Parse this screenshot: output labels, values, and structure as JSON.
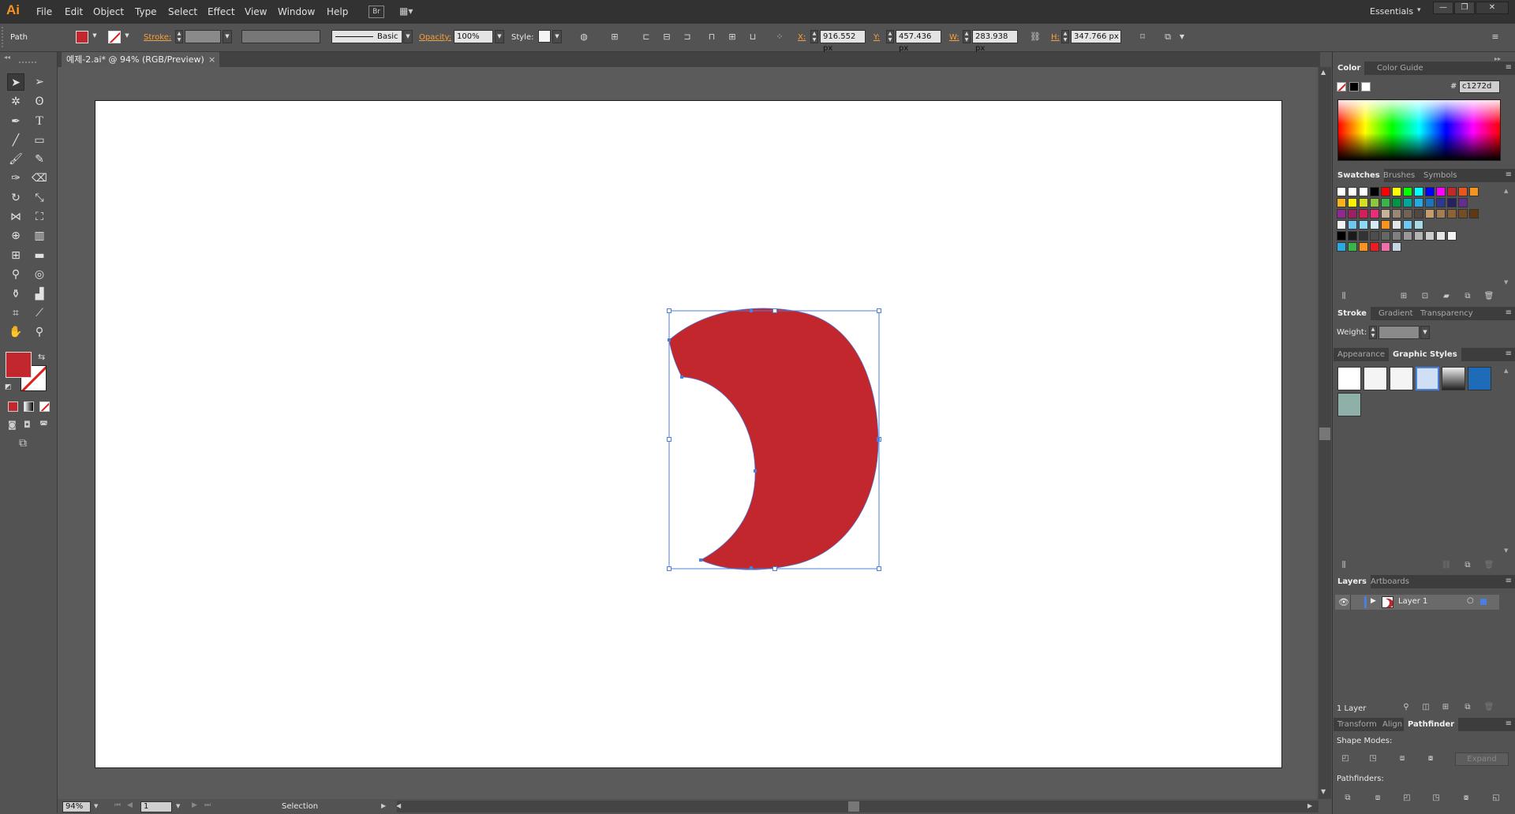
{
  "app": {
    "logo": "Ai",
    "workspace": "Essentials",
    "workspace_arrow": "▾"
  },
  "menu": [
    "File",
    "Edit",
    "Object",
    "Type",
    "Select",
    "Effect",
    "View",
    "Window",
    "Help"
  ],
  "menu_icons": {
    "bridge": "Br",
    "arrange": "▦▾"
  },
  "window_buttons": [
    "—",
    "❐",
    "✕"
  ],
  "control": {
    "object_type": "Path",
    "stroke_label": "Stroke:",
    "brush_label": "Basic",
    "opacity_label": "Opacity:",
    "opacity_value": "100%",
    "style_label": "Style:",
    "x_label": "X:",
    "x_value": "916.552 px",
    "y_label": "Y:",
    "y_value": "457.436 px",
    "w_label": "W:",
    "w_value": "283.938 px",
    "h_label": "H:",
    "h_value": "347.766 px"
  },
  "document": {
    "tab_title": "예제-2.ai* @ 94% (RGB/Preview)",
    "tab_close": "×",
    "fill_color": "#c1272d",
    "selection_color": "#4a7fe0"
  },
  "status": {
    "zoom": "94%",
    "artboard_number": "1",
    "mode": "Selection"
  },
  "panels": {
    "color": {
      "tabs": [
        "Color",
        "Color Guide"
      ],
      "hex_symbol": "#",
      "hex_value": "c1272d"
    },
    "swatches": {
      "tabs": [
        "Swatches",
        "Brushes",
        "Symbols"
      ]
    },
    "stroke": {
      "tabs": [
        "Stroke",
        "Gradient",
        "Transparency"
      ],
      "weight_label": "Weight:"
    },
    "appearance": {
      "tabs": [
        "Appearance",
        "Graphic Styles"
      ]
    },
    "layers": {
      "tabs": [
        "Layers",
        "Artboards"
      ],
      "layer_name": "Layer 1",
      "count_label": "1 Layer"
    },
    "pathfinder": {
      "tabs": [
        "Transform",
        "Align",
        "Pathfinder"
      ],
      "shape_modes_label": "Shape Modes:",
      "expand_label": "Expand",
      "pathfinders_label": "Pathfinders:"
    }
  },
  "swatch_rows": [
    [
      "#ffffff",
      "#ffffff",
      "#ffffff",
      "#000000",
      "#ff0000",
      "#ffff00",
      "#00ff00",
      "#00ffff",
      "#0000ff",
      "#ff00ff",
      "#c1272d",
      "#e8551d",
      "#f7941d"
    ],
    [
      "#f7b21d",
      "#fff200",
      "#d7df23",
      "#8dc63f",
      "#39b54a",
      "#009444",
      "#00a79d",
      "#27aae1",
      "#1c75bc",
      "#2b3990",
      "#262262",
      "#662d91"
    ],
    [
      "#92278f",
      "#9e1f63",
      "#da1c5c",
      "#ee2a7b",
      "#c7b299",
      "#998675",
      "#736357",
      "#534741",
      "#c69c6d",
      "#a67c52",
      "#8c6239",
      "#754c24",
      "#603913"
    ],
    [
      "#f2f2f2",
      "#6fc6f0",
      "#8ed8f8",
      "#d6eaf4",
      "#f7941d",
      "#e6e6e6",
      "#6fc6f0",
      "#a7d9e9"
    ],
    [
      "#000000",
      "#1a1a1a",
      "#333333",
      "#4d4d4d",
      "#666666",
      "#808080",
      "#999999",
      "#b3b3b3",
      "#cccccc",
      "#e6e6e6",
      "#f2f2f2"
    ],
    [
      "#29abe2",
      "#39b54a",
      "#f7931e",
      "#ed1c24",
      "#f06eaa",
      "#c5d6e3"
    ]
  ],
  "icons": {
    "tools": [
      "selection-icon",
      "direct-selection-icon",
      "magic-wand-icon",
      "lasso-icon",
      "pen-icon",
      "type-icon",
      "line-icon",
      "rectangle-icon",
      "paintbrush-icon",
      "pencil-icon",
      "blob-brush-icon",
      "eraser-icon",
      "rotate-icon",
      "scale-icon",
      "width-icon",
      "free-transform-icon",
      "shape-builder-icon",
      "perspective-grid-icon",
      "mesh-icon",
      "gradient-icon",
      "eyedropper-icon",
      "blend-icon",
      "symbol-sprayer-icon",
      "column-graph-icon",
      "artboard-icon",
      "slice-icon",
      "hand-icon",
      "zoom-icon"
    ]
  }
}
